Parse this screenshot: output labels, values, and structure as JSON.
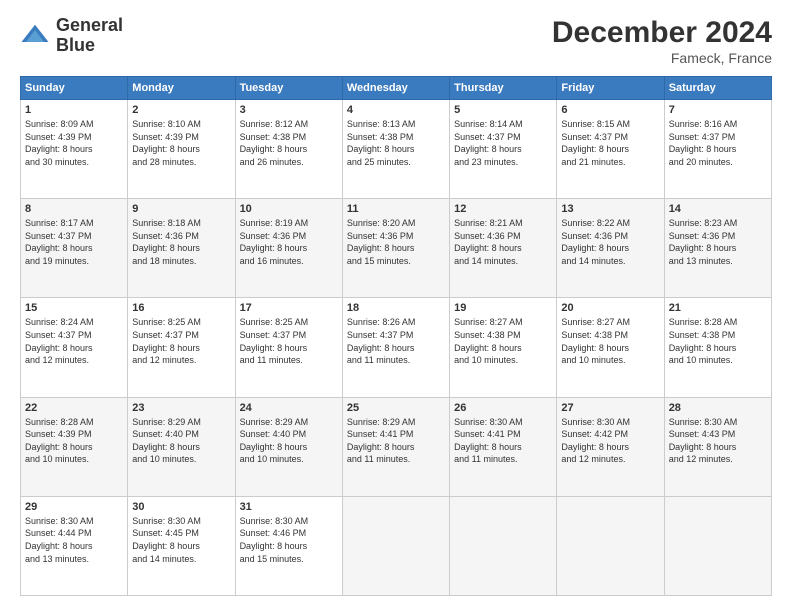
{
  "logo": {
    "line1": "General",
    "line2": "Blue"
  },
  "title": "December 2024",
  "location": "Fameck, France",
  "days_of_week": [
    "Sunday",
    "Monday",
    "Tuesday",
    "Wednesday",
    "Thursday",
    "Friday",
    "Saturday"
  ],
  "weeks": [
    [
      {
        "day": "1",
        "sunrise": "8:09 AM",
        "sunset": "4:39 PM",
        "daylight": "8 hours and 30 minutes."
      },
      {
        "day": "2",
        "sunrise": "8:10 AM",
        "sunset": "4:39 PM",
        "daylight": "8 hours and 28 minutes."
      },
      {
        "day": "3",
        "sunrise": "8:12 AM",
        "sunset": "4:38 PM",
        "daylight": "8 hours and 26 minutes."
      },
      {
        "day": "4",
        "sunrise": "8:13 AM",
        "sunset": "4:38 PM",
        "daylight": "8 hours and 25 minutes."
      },
      {
        "day": "5",
        "sunrise": "8:14 AM",
        "sunset": "4:37 PM",
        "daylight": "8 hours and 23 minutes."
      },
      {
        "day": "6",
        "sunrise": "8:15 AM",
        "sunset": "4:37 PM",
        "daylight": "8 hours and 21 minutes."
      },
      {
        "day": "7",
        "sunrise": "8:16 AM",
        "sunset": "4:37 PM",
        "daylight": "8 hours and 20 minutes."
      }
    ],
    [
      {
        "day": "8",
        "sunrise": "8:17 AM",
        "sunset": "4:37 PM",
        "daylight": "8 hours and 19 minutes."
      },
      {
        "day": "9",
        "sunrise": "8:18 AM",
        "sunset": "4:36 PM",
        "daylight": "8 hours and 18 minutes."
      },
      {
        "day": "10",
        "sunrise": "8:19 AM",
        "sunset": "4:36 PM",
        "daylight": "8 hours and 16 minutes."
      },
      {
        "day": "11",
        "sunrise": "8:20 AM",
        "sunset": "4:36 PM",
        "daylight": "8 hours and 15 minutes."
      },
      {
        "day": "12",
        "sunrise": "8:21 AM",
        "sunset": "4:36 PM",
        "daylight": "8 hours and 14 minutes."
      },
      {
        "day": "13",
        "sunrise": "8:22 AM",
        "sunset": "4:36 PM",
        "daylight": "8 hours and 14 minutes."
      },
      {
        "day": "14",
        "sunrise": "8:23 AM",
        "sunset": "4:36 PM",
        "daylight": "8 hours and 13 minutes."
      }
    ],
    [
      {
        "day": "15",
        "sunrise": "8:24 AM",
        "sunset": "4:37 PM",
        "daylight": "8 hours and 12 minutes."
      },
      {
        "day": "16",
        "sunrise": "8:25 AM",
        "sunset": "4:37 PM",
        "daylight": "8 hours and 12 minutes."
      },
      {
        "day": "17",
        "sunrise": "8:25 AM",
        "sunset": "4:37 PM",
        "daylight": "8 hours and 11 minutes."
      },
      {
        "day": "18",
        "sunrise": "8:26 AM",
        "sunset": "4:37 PM",
        "daylight": "8 hours and 11 minutes."
      },
      {
        "day": "19",
        "sunrise": "8:27 AM",
        "sunset": "4:38 PM",
        "daylight": "8 hours and 10 minutes."
      },
      {
        "day": "20",
        "sunrise": "8:27 AM",
        "sunset": "4:38 PM",
        "daylight": "8 hours and 10 minutes."
      },
      {
        "day": "21",
        "sunrise": "8:28 AM",
        "sunset": "4:38 PM",
        "daylight": "8 hours and 10 minutes."
      }
    ],
    [
      {
        "day": "22",
        "sunrise": "8:28 AM",
        "sunset": "4:39 PM",
        "daylight": "8 hours and 10 minutes."
      },
      {
        "day": "23",
        "sunrise": "8:29 AM",
        "sunset": "4:40 PM",
        "daylight": "8 hours and 10 minutes."
      },
      {
        "day": "24",
        "sunrise": "8:29 AM",
        "sunset": "4:40 PM",
        "daylight": "8 hours and 10 minutes."
      },
      {
        "day": "25",
        "sunrise": "8:29 AM",
        "sunset": "4:41 PM",
        "daylight": "8 hours and 11 minutes."
      },
      {
        "day": "26",
        "sunrise": "8:30 AM",
        "sunset": "4:41 PM",
        "daylight": "8 hours and 11 minutes."
      },
      {
        "day": "27",
        "sunrise": "8:30 AM",
        "sunset": "4:42 PM",
        "daylight": "8 hours and 12 minutes."
      },
      {
        "day": "28",
        "sunrise": "8:30 AM",
        "sunset": "4:43 PM",
        "daylight": "8 hours and 12 minutes."
      }
    ],
    [
      {
        "day": "29",
        "sunrise": "8:30 AM",
        "sunset": "4:44 PM",
        "daylight": "8 hours and 13 minutes."
      },
      {
        "day": "30",
        "sunrise": "8:30 AM",
        "sunset": "4:45 PM",
        "daylight": "8 hours and 14 minutes."
      },
      {
        "day": "31",
        "sunrise": "8:30 AM",
        "sunset": "4:46 PM",
        "daylight": "8 hours and 15 minutes."
      },
      null,
      null,
      null,
      null
    ]
  ]
}
